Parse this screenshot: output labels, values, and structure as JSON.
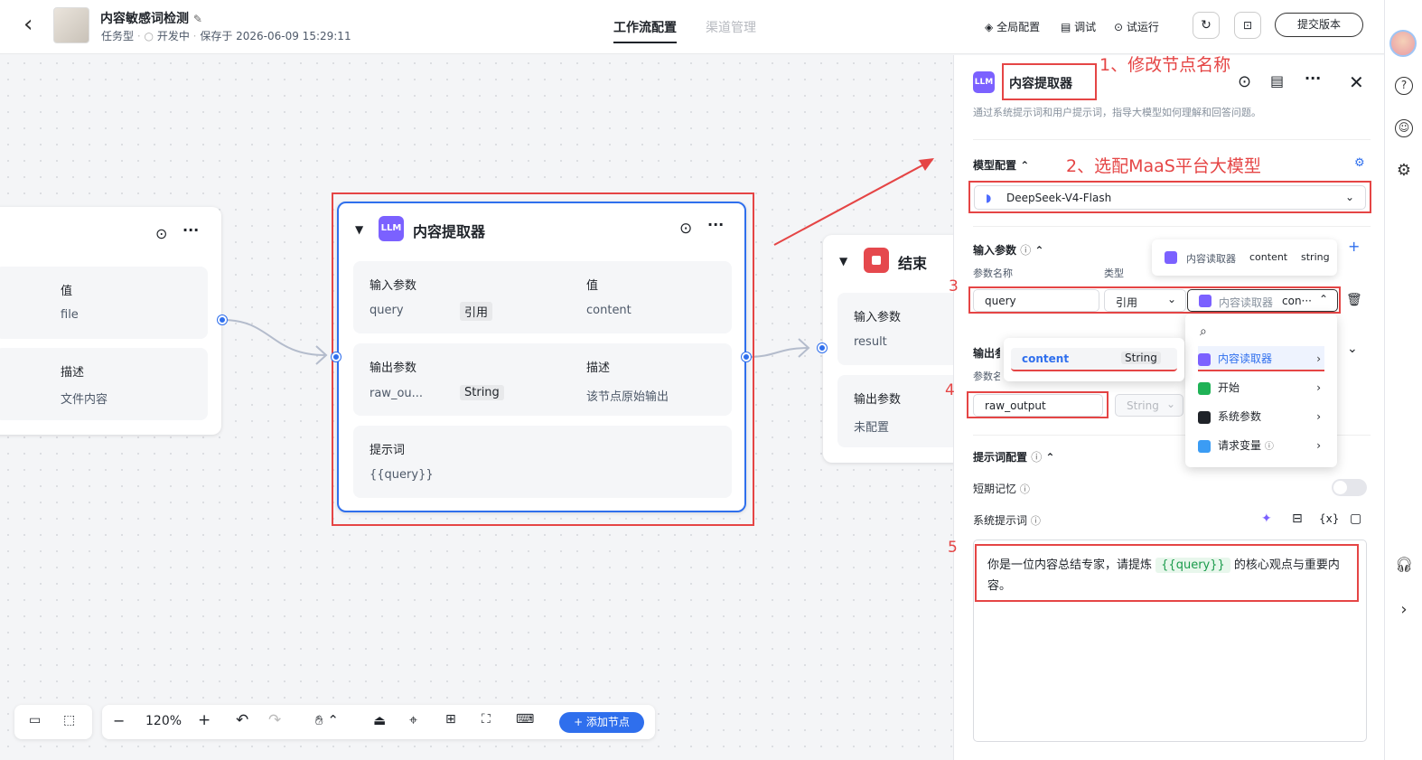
{
  "header": {
    "back": "‹",
    "title": "内容敏感词检测",
    "type": "任务型",
    "status": "开发中",
    "saved": "保存于 2026-06-09 15:29:11",
    "tabs": [
      "工作流配置",
      "渠道管理"
    ],
    "actions": [
      "全局配置",
      "调试",
      "试运行"
    ],
    "submit": "提交版本"
  },
  "start_node": {
    "col_value": "值",
    "value": "file",
    "col_desc": "描述",
    "desc": "文件内容"
  },
  "llm_node": {
    "title": "内容提取器",
    "badge": "LLM",
    "in_label": "输入参数",
    "in_col2": "值",
    "in_name": "query",
    "in_type": "引用",
    "in_value": "content",
    "out_label": "输出参数",
    "out_col2": "描述",
    "out_name": "raw_ou...",
    "out_type": "String",
    "out_desc": "该节点原始输出",
    "prompt_label": "提示词",
    "prompt": "{{query}}"
  },
  "end_node": {
    "title": "结束",
    "in_label": "输入参数",
    "in_value": "result",
    "out_label": "输出参数",
    "out_value": "未配置"
  },
  "panel": {
    "badge": "LLM",
    "title": "内容提取器",
    "desc": "通过系统提示词和用户提示词，指导大模型如何理解和回答问题。",
    "model_label": "模型配置",
    "model": "DeepSeek-V4-Flash",
    "inparams_label": "输入参数",
    "col_name": "参数名称",
    "col_type": "类型",
    "param_name": "query",
    "param_type": "引用",
    "param_ref_node": "内容读取器",
    "param_ref_var": "con···",
    "tooltip_node": "内容读取器",
    "tooltip_var": "content",
    "tooltip_type": "string",
    "out_label": "输出参",
    "out_col": "参数名",
    "out_name": "raw_output",
    "out_type": "String",
    "prompt_cfg": "提示词配置",
    "memory": "短期记忆",
    "sys_prompt": "系统提示词",
    "prompt_before": "你是一位内容总结专家，请提炼",
    "prompt_var": "{{query}}",
    "prompt_after": "的核心观点与重要内容。",
    "var_icon": "{x}"
  },
  "dropdown": {
    "items": [
      "内容读取器",
      "开始",
      "系统参数",
      "请求变量"
    ],
    "sub_name": "content",
    "sub_type": "String"
  },
  "annotations": [
    "1、修改节点名称",
    "2、选配MaaS平台大模型",
    "3",
    "4",
    "5"
  ],
  "toolbar": {
    "zoom": "120%",
    "minus": "−",
    "plus": "+",
    "add": "+ 添加节点"
  },
  "colors": {
    "accent": "#2f6fed",
    "annotation": "#e54545",
    "llm_badge": "#7b61ff",
    "end_badge": "#e5484d"
  }
}
